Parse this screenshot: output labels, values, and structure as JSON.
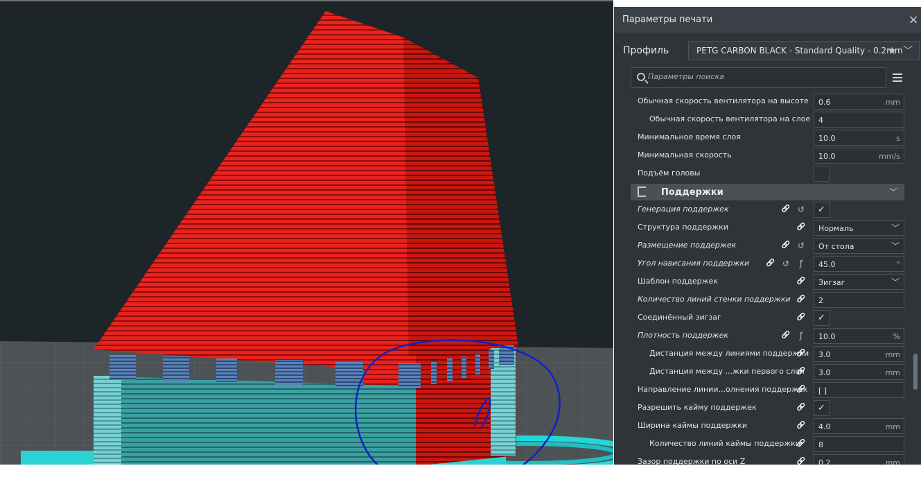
{
  "panel": {
    "title": "Параметры печати",
    "close_icon": "×",
    "profile_label": "Профиль",
    "profile_value": "PETG CARBON BLACK - Standard Quality - 0.2mm",
    "search_placeholder": "Параметры поиска"
  },
  "settings": [
    {
      "label": "Обычная скорость вентилятора на высоте",
      "value": "0.6",
      "unit": "mm",
      "type": "field",
      "indent": false,
      "italic": false,
      "icons": []
    },
    {
      "label": "Обычная скорость вентилятора на слое",
      "value": "4",
      "unit": "",
      "type": "field",
      "indent": true,
      "italic": false,
      "icons": []
    },
    {
      "label": "Минимальное время слоя",
      "value": "10.0",
      "unit": "s",
      "type": "field",
      "indent": false,
      "italic": false,
      "icons": []
    },
    {
      "label": "Минимальная скорость",
      "value": "10.0",
      "unit": "mm/s",
      "type": "field",
      "indent": false,
      "italic": false,
      "icons": []
    },
    {
      "label": "Подъём головы",
      "value": "",
      "unit": "",
      "type": "checkbox",
      "checked": false,
      "indent": false,
      "italic": false,
      "icons": []
    },
    {
      "type": "section",
      "label": "Поддержки"
    },
    {
      "label": "Генерация поддержек",
      "value": "",
      "unit": "",
      "type": "checkbox",
      "checked": true,
      "indent": false,
      "italic": true,
      "icons": [
        "link",
        "reset"
      ]
    },
    {
      "label": "Структура поддержки",
      "value": "Нормаль",
      "unit": "",
      "type": "dropdown",
      "indent": false,
      "italic": false,
      "icons": [
        "link"
      ]
    },
    {
      "label": "Размещение поддержек",
      "value": "От стола",
      "unit": "",
      "type": "dropdown",
      "indent": false,
      "italic": true,
      "icons": [
        "link",
        "reset"
      ]
    },
    {
      "label": "Угол нависания поддержки",
      "value": "45.0",
      "unit": "°",
      "type": "field",
      "indent": false,
      "italic": true,
      "icons": [
        "link",
        "reset",
        "fx"
      ]
    },
    {
      "label": "Шаблон поддержек",
      "value": "Зигзаг",
      "unit": "",
      "type": "dropdown",
      "indent": false,
      "italic": false,
      "icons": [
        "link"
      ]
    },
    {
      "label": "Количество линий стенки поддержки",
      "value": "2",
      "unit": "",
      "type": "field",
      "indent": false,
      "italic": true,
      "icons": [
        "link"
      ]
    },
    {
      "label": "Соединённый зигзаг",
      "value": "",
      "unit": "",
      "type": "checkbox",
      "checked": true,
      "indent": false,
      "italic": false,
      "icons": [
        "link"
      ]
    },
    {
      "label": "Плотность поддержек",
      "value": "10.0",
      "unit": "%",
      "type": "field",
      "indent": false,
      "italic": true,
      "icons": [
        "link",
        "fx"
      ]
    },
    {
      "label": "Дистанция между линиями поддержки",
      "value": "3.0",
      "unit": "mm",
      "type": "field",
      "indent": true,
      "italic": false,
      "icons": [
        "link"
      ]
    },
    {
      "label": "Дистанция между ...жки первого слоя",
      "value": "3.0",
      "unit": "mm",
      "type": "field",
      "indent": true,
      "italic": false,
      "icons": [
        "link"
      ]
    },
    {
      "label": "Направление линии...олнения поддержек",
      "value": "[ ]",
      "unit": "",
      "type": "field",
      "indent": false,
      "italic": false,
      "icons": [
        "link"
      ]
    },
    {
      "label": "Разрешить кайму поддержек",
      "value": "",
      "unit": "",
      "type": "checkbox",
      "checked": true,
      "indent": false,
      "italic": false,
      "icons": [
        "link"
      ]
    },
    {
      "label": "Ширина каймы поддержки",
      "value": "4.0",
      "unit": "mm",
      "type": "field",
      "indent": false,
      "italic": false,
      "icons": [
        "link"
      ]
    },
    {
      "label": "Количество линий каймы поддержки",
      "value": "8",
      "unit": "",
      "type": "field",
      "indent": true,
      "italic": false,
      "icons": [
        "link"
      ]
    },
    {
      "label": "Зазор поддержки по оси Z",
      "value": "0.2",
      "unit": "mm",
      "type": "field",
      "indent": false,
      "italic": false,
      "icons": [
        "link"
      ]
    }
  ],
  "colors": {
    "model": "#e8231d",
    "support": "#3aa6a8",
    "support_blue": "#4a6fa0",
    "annotation": "#1020c8",
    "viewport_bg": "#1e2528",
    "panel_bg": "#2f3438"
  }
}
